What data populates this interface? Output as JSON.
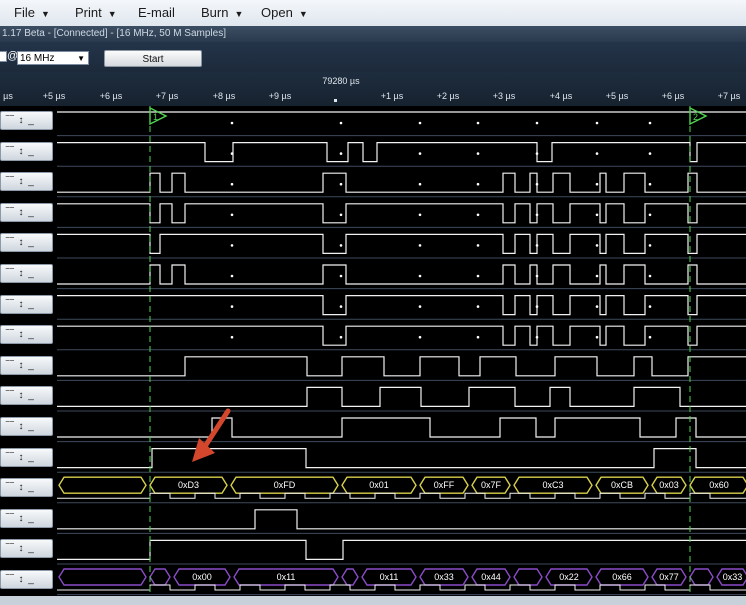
{
  "menu": [
    {
      "label": "File",
      "caret": "▼"
    },
    {
      "label": "Print",
      "caret": "▼"
    },
    {
      "label": "E-mail",
      "caret": ""
    },
    {
      "label": "Burn",
      "caret": "▼"
    },
    {
      "label": "Open",
      "caret": "▼"
    }
  ],
  "window_title": "1.17 Beta - [Connected] - [16 MHz, 50 M Samples]",
  "toolbar": {
    "at_label": "@",
    "sample_rate": "16 MHz",
    "start_label": "Start"
  },
  "ruler": {
    "center_label": "79280 µs",
    "ticks": [
      "µs",
      "+5 µs",
      "+6 µs",
      "+7 µs",
      "+8 µs",
      "+9 µs",
      "+1 µs",
      "+2 µs",
      "+3 µs",
      "+4 µs",
      "+5 µs",
      "+6 µs",
      "+7 µs"
    ]
  },
  "channels": {
    "count": 16,
    "button_glyph": "‾‾ ↕ _"
  },
  "bus_8": {
    "color": "#d8d04a",
    "values": [
      "0xD3",
      "0xFD",
      "0x01",
      "0xFF",
      "0x7F",
      "0xC3",
      "0xCB",
      "0x03",
      "0x60"
    ]
  },
  "bus_15": {
    "color": "#8a4cc8",
    "values": [
      "0x00",
      "0x11",
      "0x11",
      "0x33",
      "0x44",
      "0x22",
      "0x66",
      "0x77",
      "0x33"
    ]
  },
  "markers": {
    "marker1": "1",
    "marker2": "2",
    "color": "#4fd44f"
  },
  "arrow_color": "#d5472c"
}
